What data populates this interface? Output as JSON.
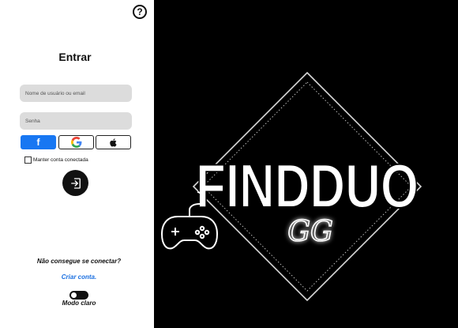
{
  "login": {
    "title": "Entrar",
    "username_placeholder": "Nome de usuário ou email",
    "password_placeholder": "Senha",
    "keep_connected_label": "Manter conta conectada",
    "cant_connect_text": "Não consegue se conectar?",
    "create_account_link": "Criar conta.",
    "mode_label": "Modo claro",
    "help_symbol": "?"
  },
  "social": {
    "facebook_glyph": "f",
    "google_glyph": "G"
  },
  "brand": {
    "logo_main": "FINDDUO",
    "logo_sub": "GG"
  },
  "icons": [
    "help-icon",
    "facebook-icon",
    "google-icon",
    "apple-icon",
    "login-arrow-icon",
    "gamepad-icon"
  ],
  "colors": {
    "facebook_blue": "#1877f2",
    "link_blue": "#1a6fe0",
    "input_gray": "#dcdcdc"
  }
}
